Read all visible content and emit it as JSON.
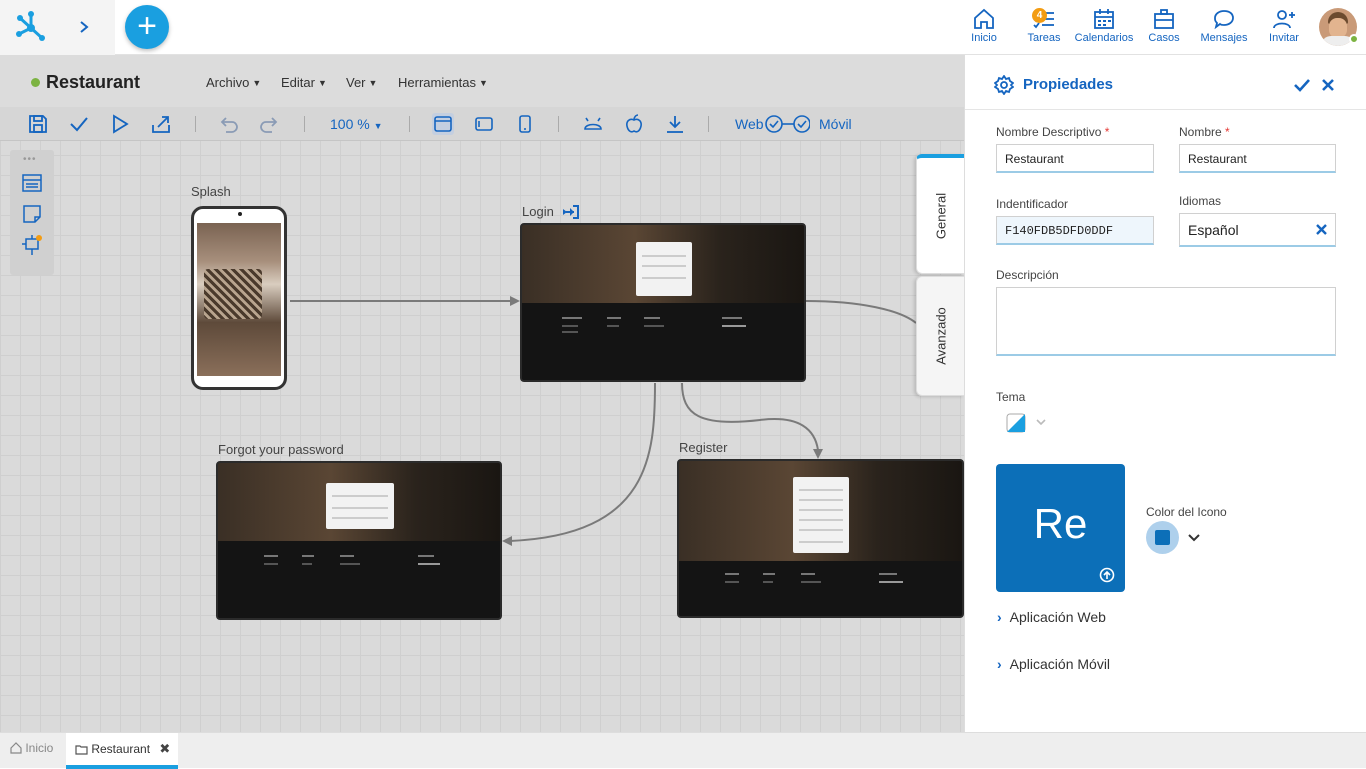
{
  "topnav": {
    "items": [
      {
        "label": "Inicio",
        "icon": "home-icon"
      },
      {
        "label": "Tareas",
        "icon": "tasks-icon",
        "badge": "4"
      },
      {
        "label": "Calendarios",
        "icon": "calendar-icon"
      },
      {
        "label": "Casos",
        "icon": "briefcase-icon"
      },
      {
        "label": "Mensajes",
        "icon": "chat-icon"
      },
      {
        "label": "Invitar",
        "icon": "invite-icon"
      }
    ],
    "add_label": "+"
  },
  "app": {
    "title": "Restaurant",
    "menus": [
      "Archivo",
      "Editar",
      "Ver",
      "Herramientas"
    ]
  },
  "toolbar": {
    "zoom": "100 %",
    "web_label": "Web",
    "movil_label": "Móvil"
  },
  "nodes": {
    "splash": "Splash",
    "login": "Login",
    "forgot": "Forgot your password",
    "register": "Register"
  },
  "side_tabs": [
    "General",
    "Avanzado"
  ],
  "panel": {
    "title": "Propiedades",
    "nombre_descriptivo_label": "Nombre Descriptivo",
    "nombre_descriptivo": "Restaurant",
    "nombre_label": "Nombre",
    "nombre": "Restaurant",
    "identificador_label": "Indentificador",
    "identificador": "F140FDB5DFD0DDF",
    "idiomas_label": "Idiomas",
    "idioma": "Español",
    "descripcion_label": "Descripción",
    "tema_label": "Tema",
    "icon_text": "Re",
    "color_icono_label": "Color del Icono",
    "icon_color": "#0c6fb8",
    "sections": [
      "Aplicación Web",
      "Aplicación Móvil"
    ]
  },
  "bottom_tabs": [
    {
      "label": "Inicio"
    },
    {
      "label": "Restaurant"
    }
  ],
  "colors": {
    "accent": "#1565c0",
    "fab": "#1a9fe0",
    "status": "#7cb342",
    "badge": "#f39c12"
  }
}
